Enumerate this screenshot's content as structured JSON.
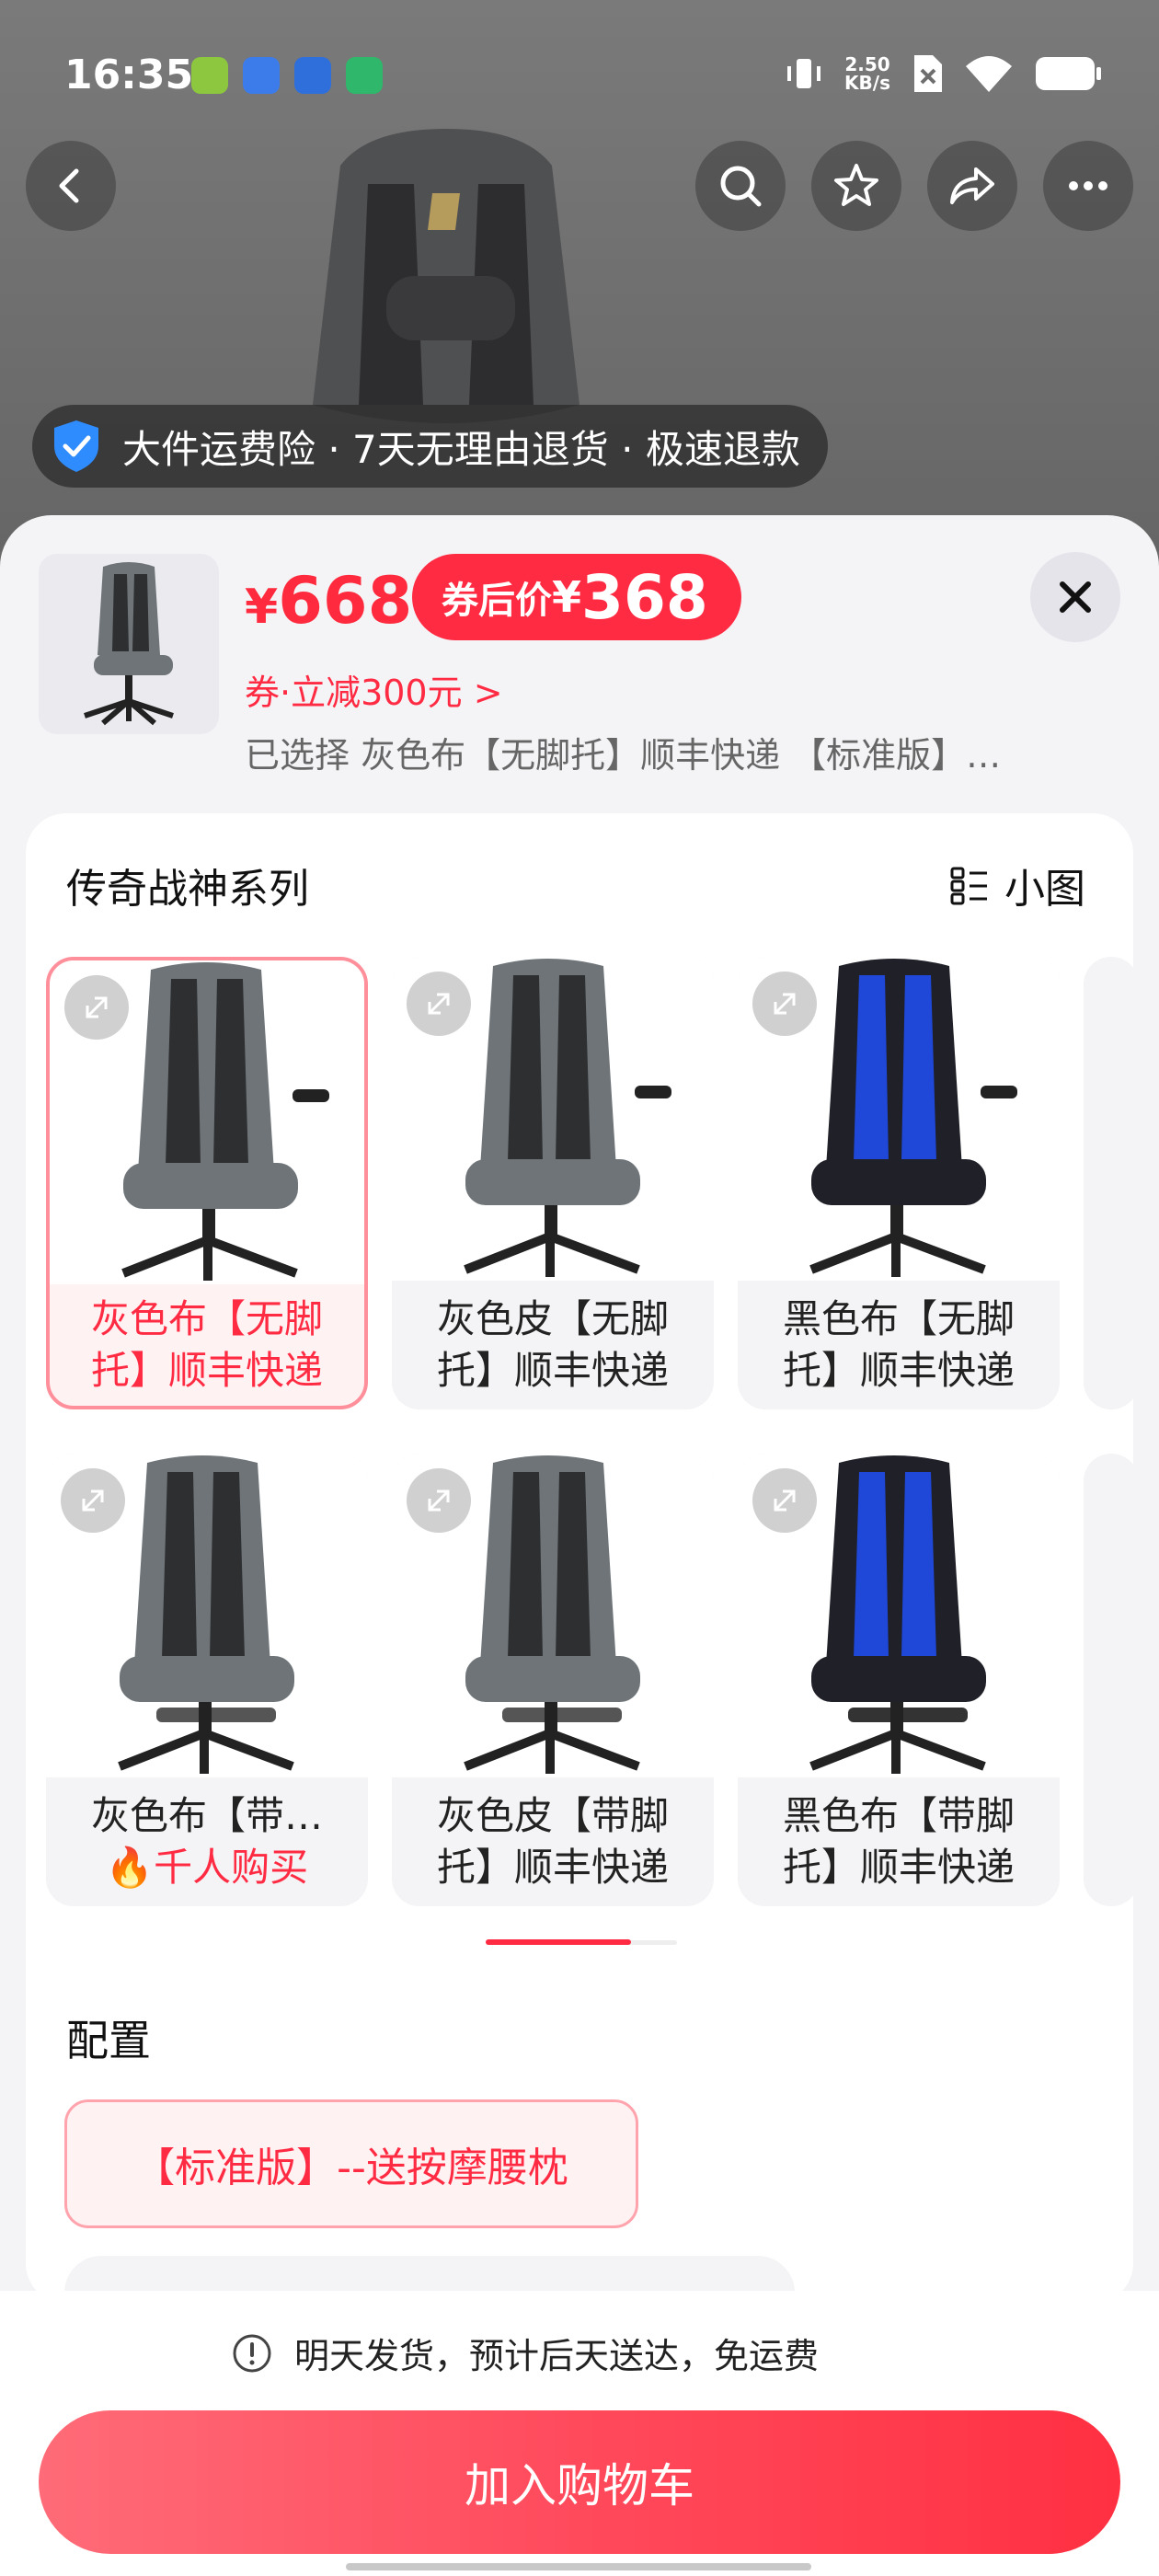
{
  "status": {
    "time": "16:35",
    "net_speed_value": "2.50",
    "net_speed_unit": "KB/s"
  },
  "promo": {
    "text": "大件运费险 · 7天无理由退货 · 极速退款"
  },
  "sheet": {
    "price_symbol": "¥",
    "price": "668",
    "coupon_label": "券后价",
    "coupon_price": "368",
    "coupon_line": "券·立减300元 >",
    "selected": "已选择 灰色布【无脚托】顺丰快递 【标准版】…"
  },
  "variants": {
    "series_title": "传奇战神系列",
    "view_toggle": "小图",
    "items": [
      {
        "label": "灰色布【无脚托】顺丰快递",
        "selected": true
      },
      {
        "label": "灰色皮【无脚托】顺丰快递",
        "selected": false
      },
      {
        "label": "黑色布【无脚托】顺丰快递",
        "selected": false
      },
      {
        "label": "灰色布【带…",
        "sub": "千人购买",
        "selected": false
      },
      {
        "label": "灰色皮【带脚托】顺丰快递",
        "selected": false
      },
      {
        "label": "黑色布【带脚托】顺丰快递",
        "selected": false
      }
    ]
  },
  "config": {
    "title": "配置",
    "option": "【标准版】--送按摩腰枕"
  },
  "footer": {
    "shipping": "明天发货，预计后天送达，免运费",
    "add_to_cart": "加入购物车"
  },
  "colors": {
    "accent": "#ff2b43",
    "button_gradient_start": "#ff6b78",
    "button_gradient_end": "#ff3042"
  }
}
